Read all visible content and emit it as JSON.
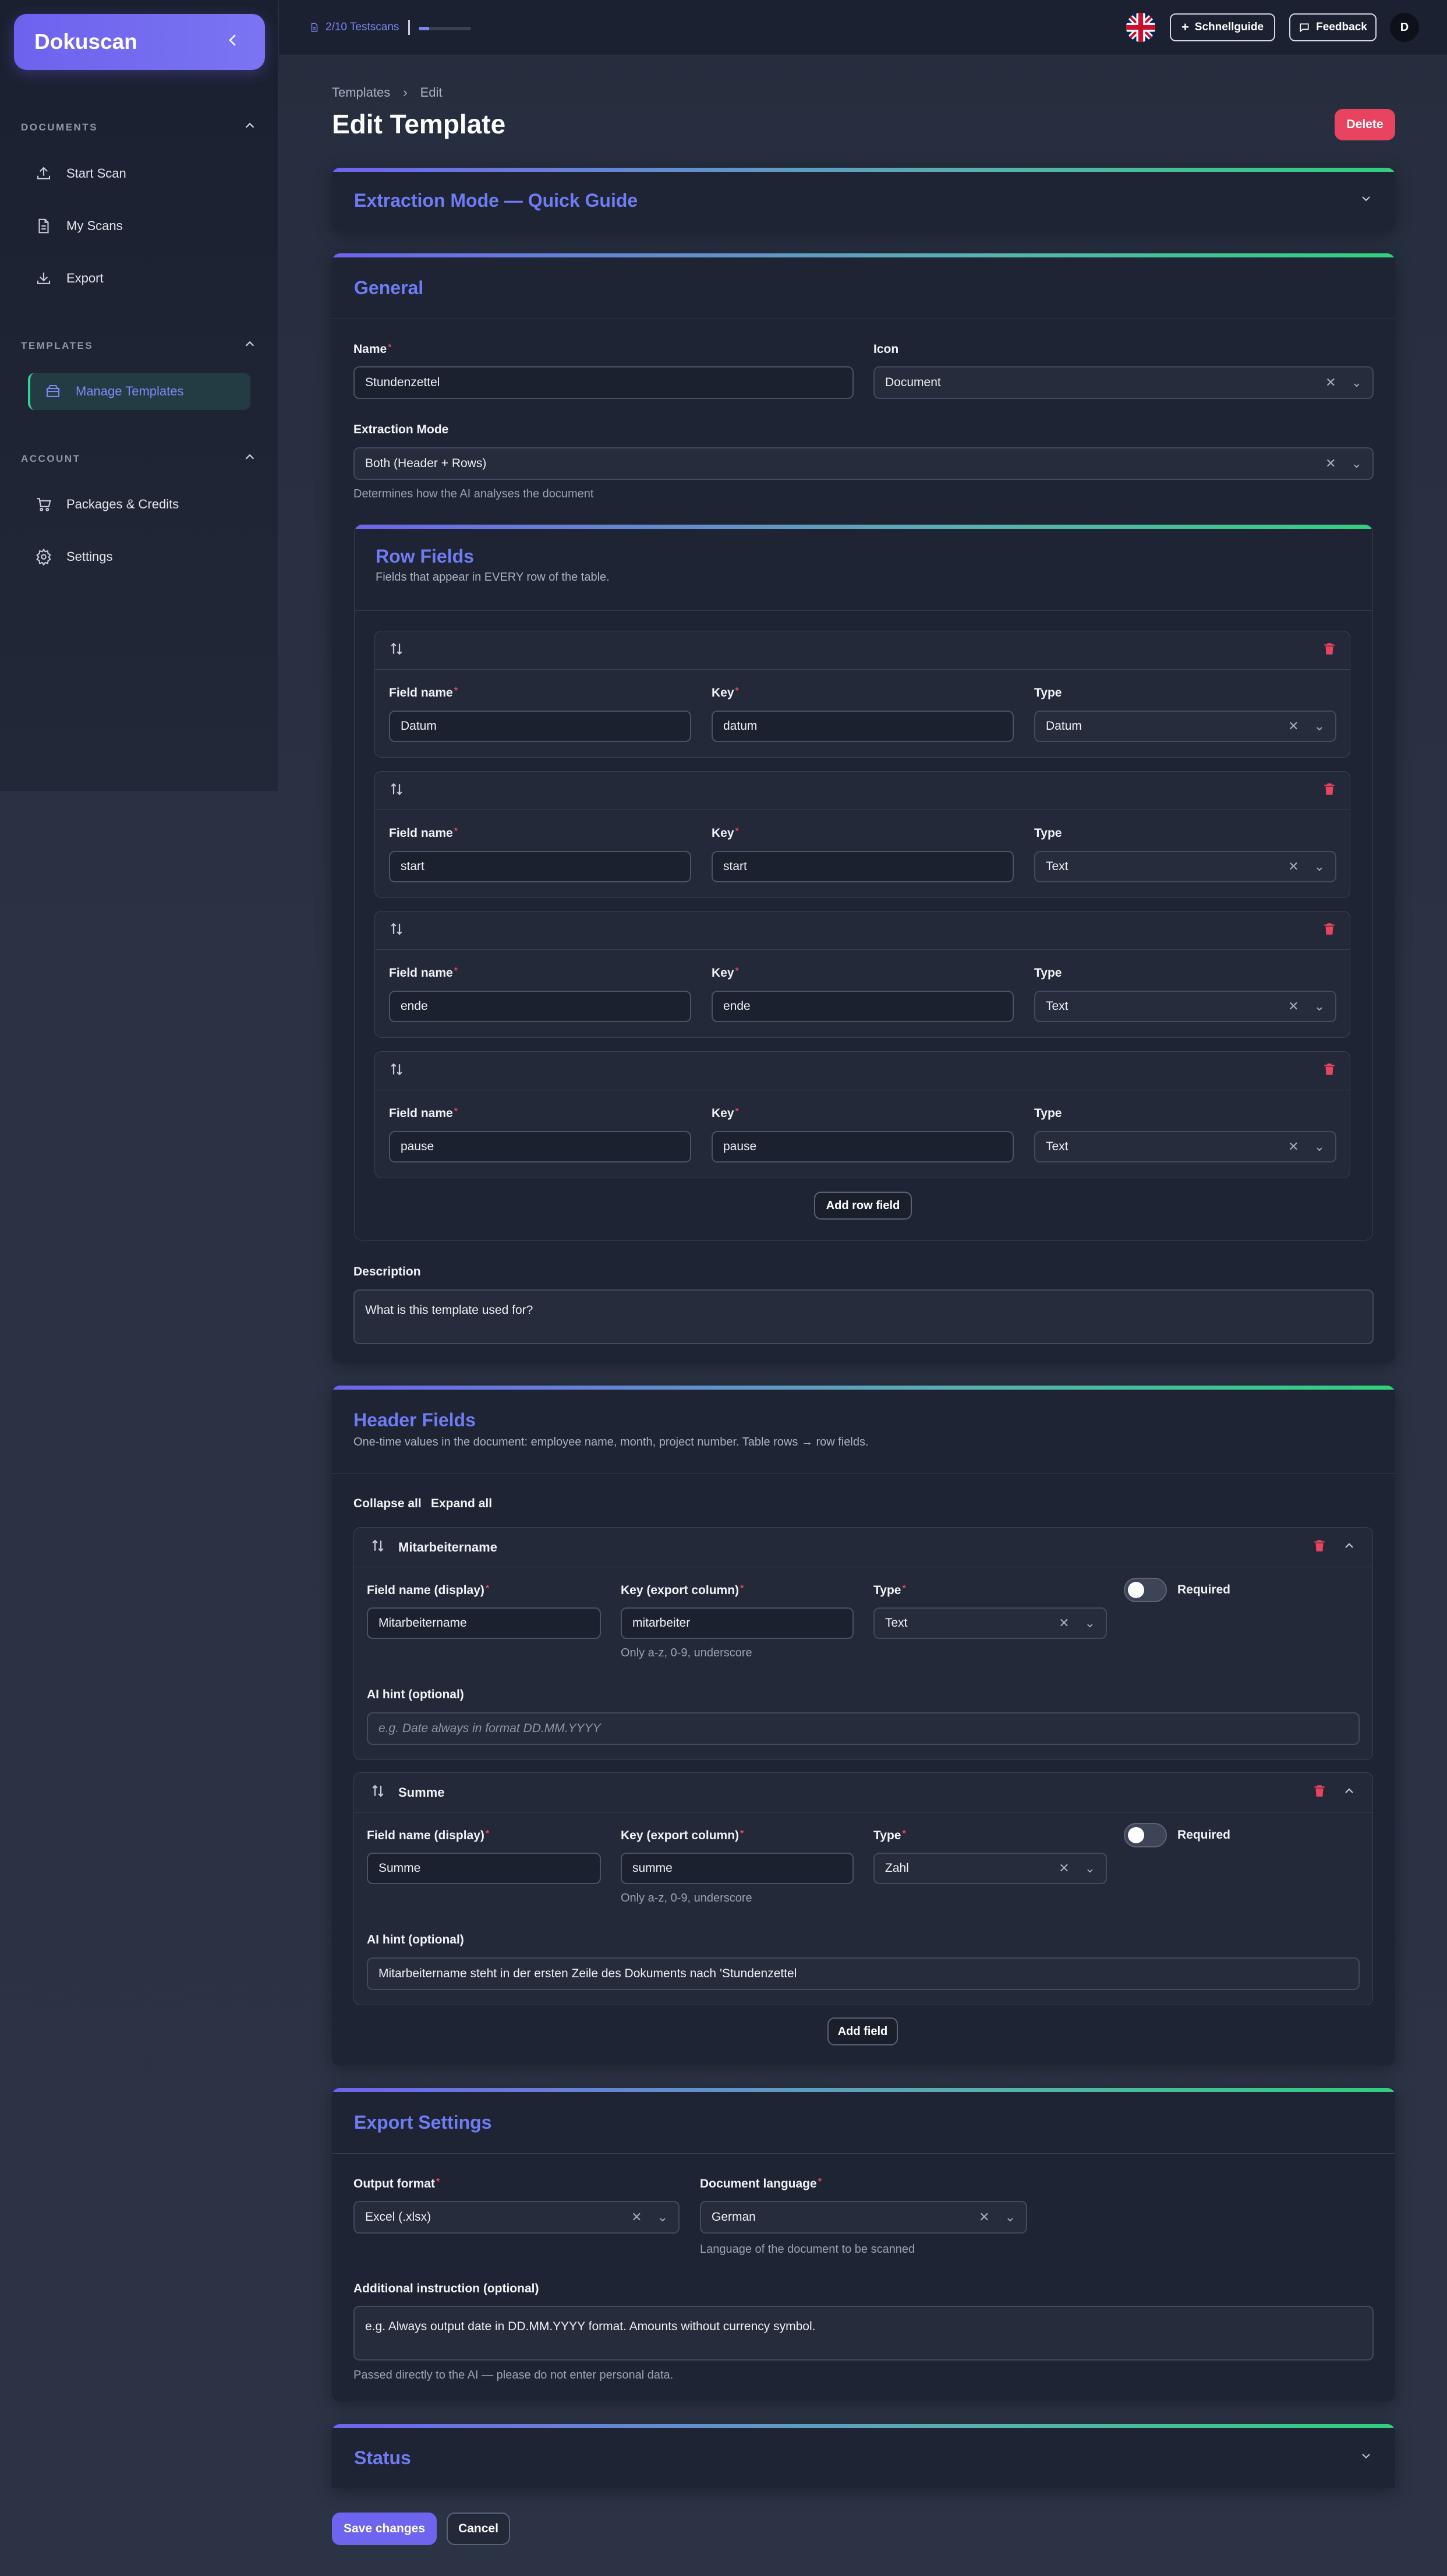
{
  "app": {
    "name": "Dokuscan"
  },
  "sidebar": {
    "sections": [
      {
        "label": "DOCUMENTS"
      },
      {
        "label": "TEMPLATES"
      },
      {
        "label": "ACCOUNT"
      }
    ],
    "items": [
      {
        "label": "Start Scan",
        "icon": "upload-icon"
      },
      {
        "label": "My Scans",
        "icon": "file-icon"
      },
      {
        "label": "Export",
        "icon": "download-icon"
      },
      {
        "label": "Manage Templates",
        "icon": "box-icon",
        "active": true
      },
      {
        "label": "Packages & Credits",
        "icon": "cart-icon"
      },
      {
        "label": "Settings",
        "icon": "gear-icon"
      }
    ]
  },
  "topbar": {
    "testscans": "2/10 Testscans",
    "testscans_progress": 0.2,
    "quick_guide": "Schnellguide",
    "feedback": "Feedback",
    "avatar": "D"
  },
  "breadcrumb": {
    "parent": "Templates",
    "current": "Edit",
    "separator": "›"
  },
  "page": {
    "title": "Edit Template",
    "delete": "Delete"
  },
  "quick_guide_card": {
    "title": "Extraction Mode — Quick Guide"
  },
  "general": {
    "title": "General",
    "name_label": "Name",
    "name_value": "Stundenzettel",
    "icon_label": "Icon",
    "icon_value": "Document",
    "mode_label": "Extraction Mode",
    "mode_value": "Both (Header + Rows)",
    "mode_help": "Determines how the AI analyses the document",
    "row_fields": {
      "title": "Row Fields",
      "subtitle": "Fields that appear in EVERY row of the table.",
      "field_name_label": "Field name",
      "key_label": "Key",
      "type_label": "Type",
      "rows": [
        {
          "name": "Datum",
          "key": "datum",
          "type": "Datum"
        },
        {
          "name": "start",
          "key": "start",
          "type": "Text"
        },
        {
          "name": "ende",
          "key": "ende",
          "type": "Text"
        },
        {
          "name": "pause",
          "key": "pause",
          "type": "Text"
        }
      ],
      "add": "Add row field"
    },
    "description_label": "Description",
    "description_placeholder": "What is this template used for?"
  },
  "header_fields": {
    "title": "Header Fields",
    "subtitle": "One-time values in the document: employee name, month, project number. Table rows → row fields.",
    "collapse_all": "Collapse all",
    "expand_all": "Expand all",
    "field_name_label": "Field name (display)",
    "key_label": "Key (export column)",
    "type_label": "Type",
    "required_label": "Required",
    "key_help": "Only a-z, 0-9, underscore",
    "hint_label": "AI hint (optional)",
    "items": [
      {
        "title": "Mitarbeitername",
        "name": "Mitarbeitername",
        "key": "mitarbeiter",
        "type": "Text",
        "hint": "",
        "hint_placeholder": "e.g. Date always in format DD.MM.YYYY"
      },
      {
        "title": "Summe",
        "name": "Summe",
        "key": "summe",
        "type": "Zahl",
        "hint": "Mitarbeitername steht in der ersten Zeile des Dokuments nach 'Stundenzettel",
        "hint_placeholder": ""
      }
    ],
    "add": "Add field"
  },
  "export_settings": {
    "title": "Export Settings",
    "format_label": "Output format",
    "format_value": "Excel (.xlsx)",
    "language_label": "Document language",
    "language_value": "German",
    "language_help": "Language of the document to be scanned",
    "instruction_label": "Additional instruction (optional)",
    "instruction_value": "e.g. Always output date in DD.MM.YYYY format. Amounts without currency symbol.",
    "instruction_help": "Passed directly to the AI — please do not enter personal data."
  },
  "status_card": {
    "title": "Status"
  },
  "actions": {
    "save": "Save changes",
    "cancel": "Cancel"
  }
}
